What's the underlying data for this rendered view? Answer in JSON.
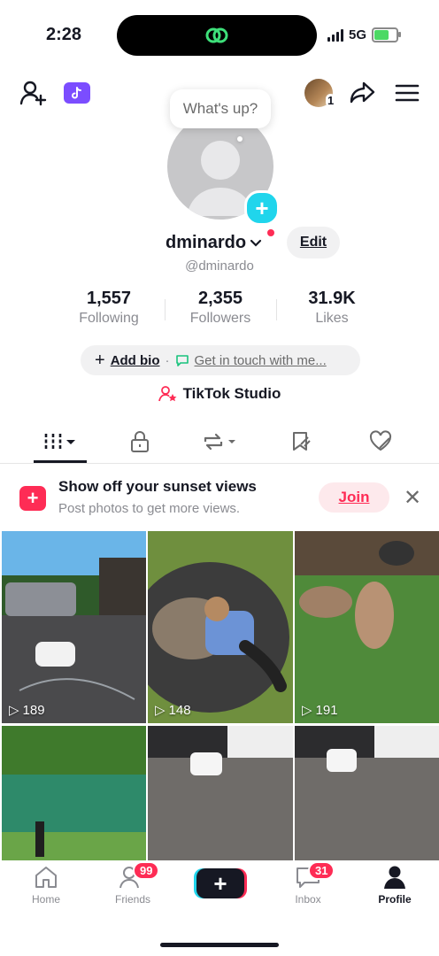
{
  "status_bar": {
    "time": "2:28",
    "network": "5G"
  },
  "avatar_tooltip": "What's up?",
  "profile": {
    "display_name": "dminardo",
    "handle": "@dminardo",
    "edit_label": "Edit",
    "friend_count_badge": "1"
  },
  "stats": [
    {
      "value": "1,557",
      "label": "Following"
    },
    {
      "value": "2,355",
      "label": "Followers"
    },
    {
      "value": "31.9K",
      "label": "Likes"
    }
  ],
  "bio": {
    "add_bio": "Add bio",
    "separator": "·",
    "contact": "Get in touch with me..."
  },
  "studio_label": "TikTok Studio",
  "banner": {
    "title": "Show off your sunset views",
    "subtitle": "Post photos to get more views.",
    "join_label": "Join"
  },
  "videos": [
    {
      "views": "189"
    },
    {
      "views": "148"
    },
    {
      "views": "191"
    }
  ],
  "nav": {
    "home": "Home",
    "friends": "Friends",
    "friends_badge": "99",
    "inbox": "Inbox",
    "inbox_badge": "31",
    "profile": "Profile"
  },
  "colors": {
    "accent": "#fe2c55",
    "cyan": "#20d5ec",
    "purple": "#7b4dff"
  }
}
